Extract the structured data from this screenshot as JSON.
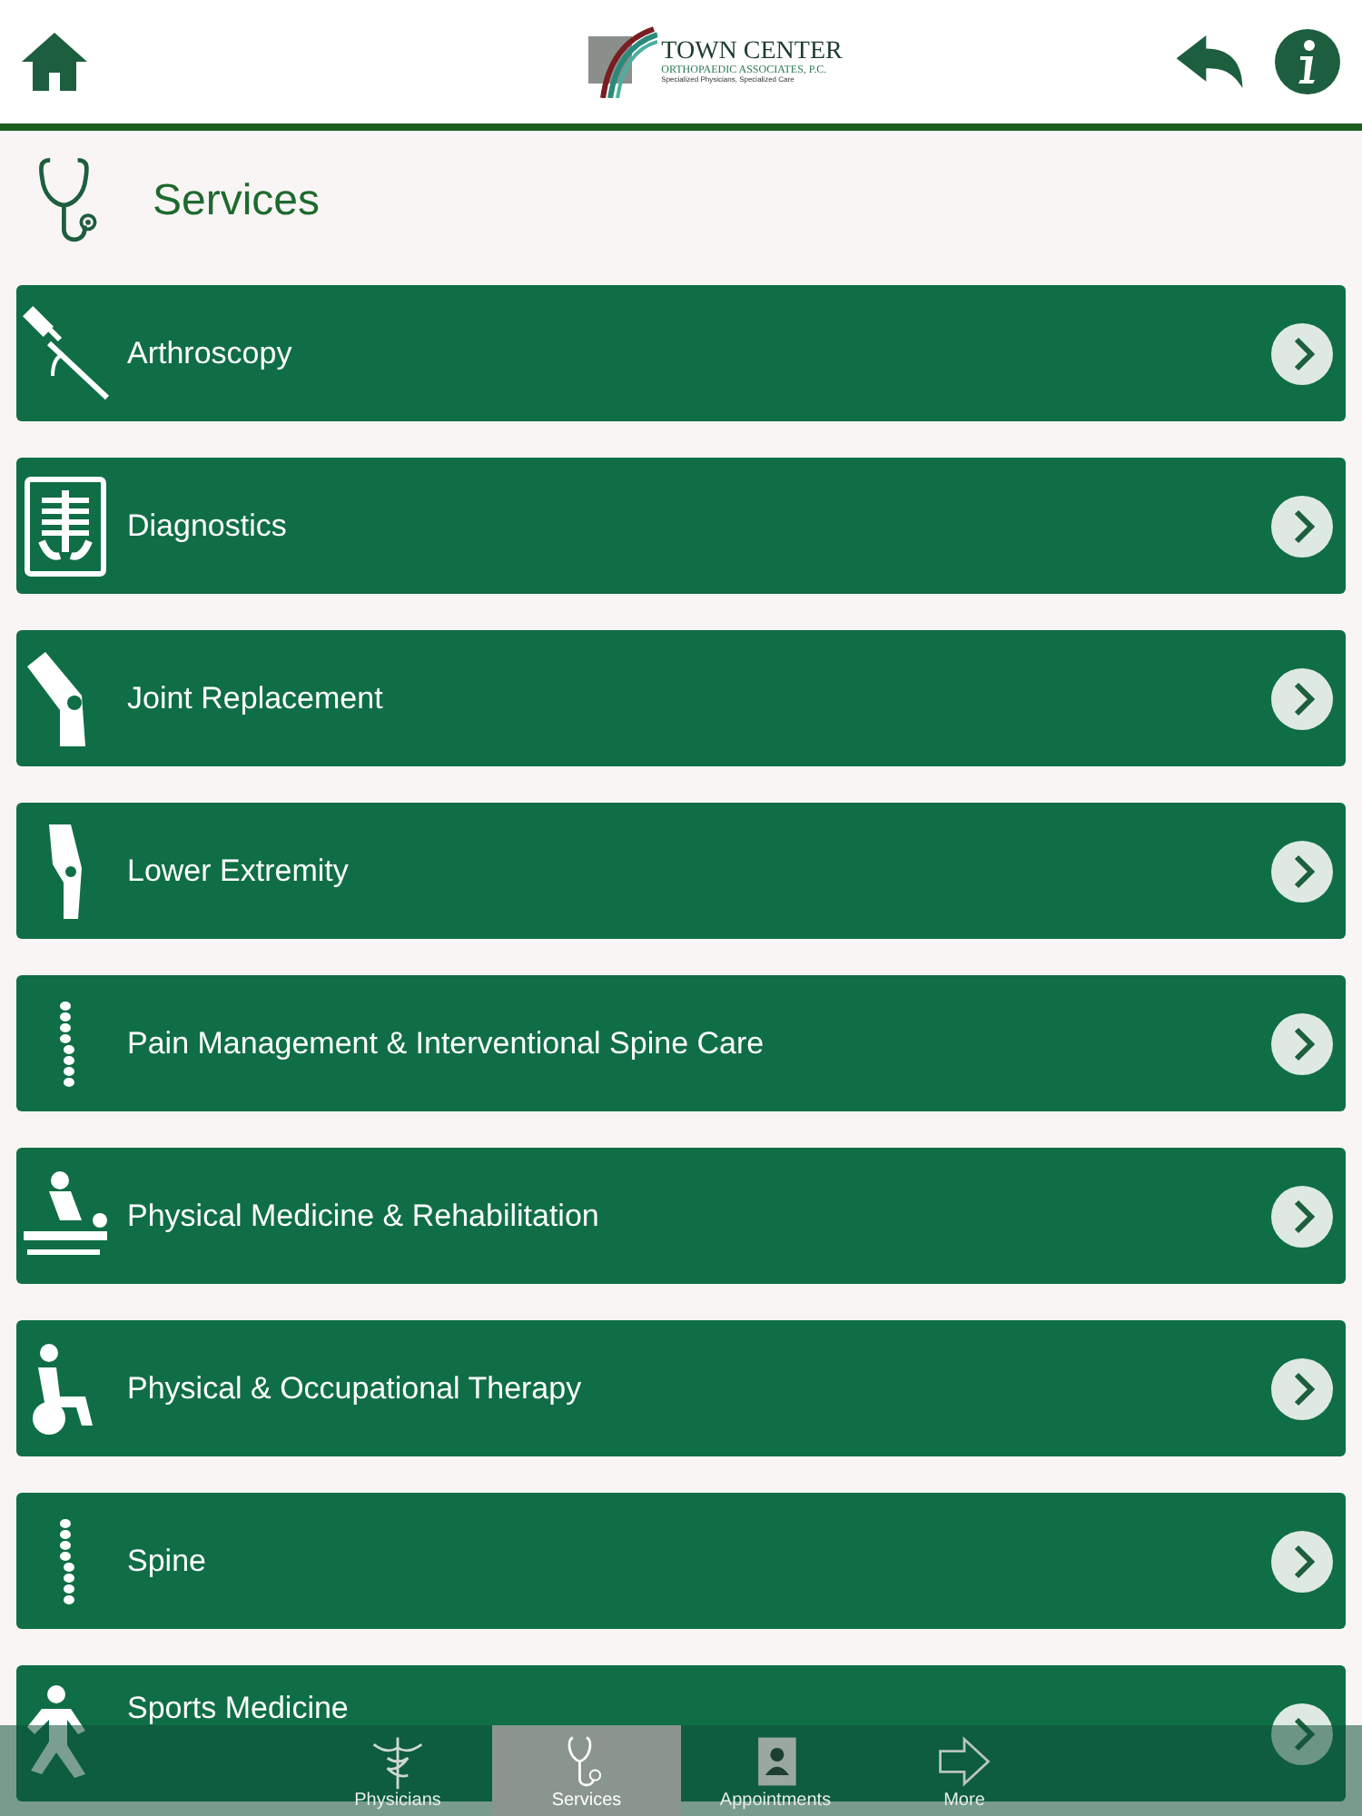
{
  "header": {
    "logo": {
      "name": "TOWN CENTER",
      "subtitle": "ORTHOPAEDIC ASSOCIATES, P.C.",
      "tagline": "Specialized Physicians, Specialized Care"
    }
  },
  "page_title": "Services",
  "services": [
    {
      "label": "Arthroscopy",
      "kind": "needle"
    },
    {
      "label": "Diagnostics",
      "kind": "xray"
    },
    {
      "label": "Joint Replacement",
      "kind": "knee"
    },
    {
      "label": "Lower Extremity",
      "kind": "leg"
    },
    {
      "label": "Pain Management & Interventional Spine Care",
      "kind": "spine"
    },
    {
      "label": "Physical Medicine & Rehabilitation",
      "kind": "massage"
    },
    {
      "label": "Physical & Occupational Therapy",
      "kind": "wheelchair"
    },
    {
      "label": "Spine",
      "kind": "spine"
    },
    {
      "label": "Sports Medicine",
      "kind": "runner"
    }
  ],
  "tab_bar": [
    {
      "label": "Physicians",
      "kind": "caduceus",
      "selected": false
    },
    {
      "label": "Services",
      "kind": "stethoscope",
      "selected": true
    },
    {
      "label": "Appointments",
      "kind": "contacts",
      "selected": false
    },
    {
      "label": "More",
      "kind": "arrow",
      "selected": false
    }
  ]
}
